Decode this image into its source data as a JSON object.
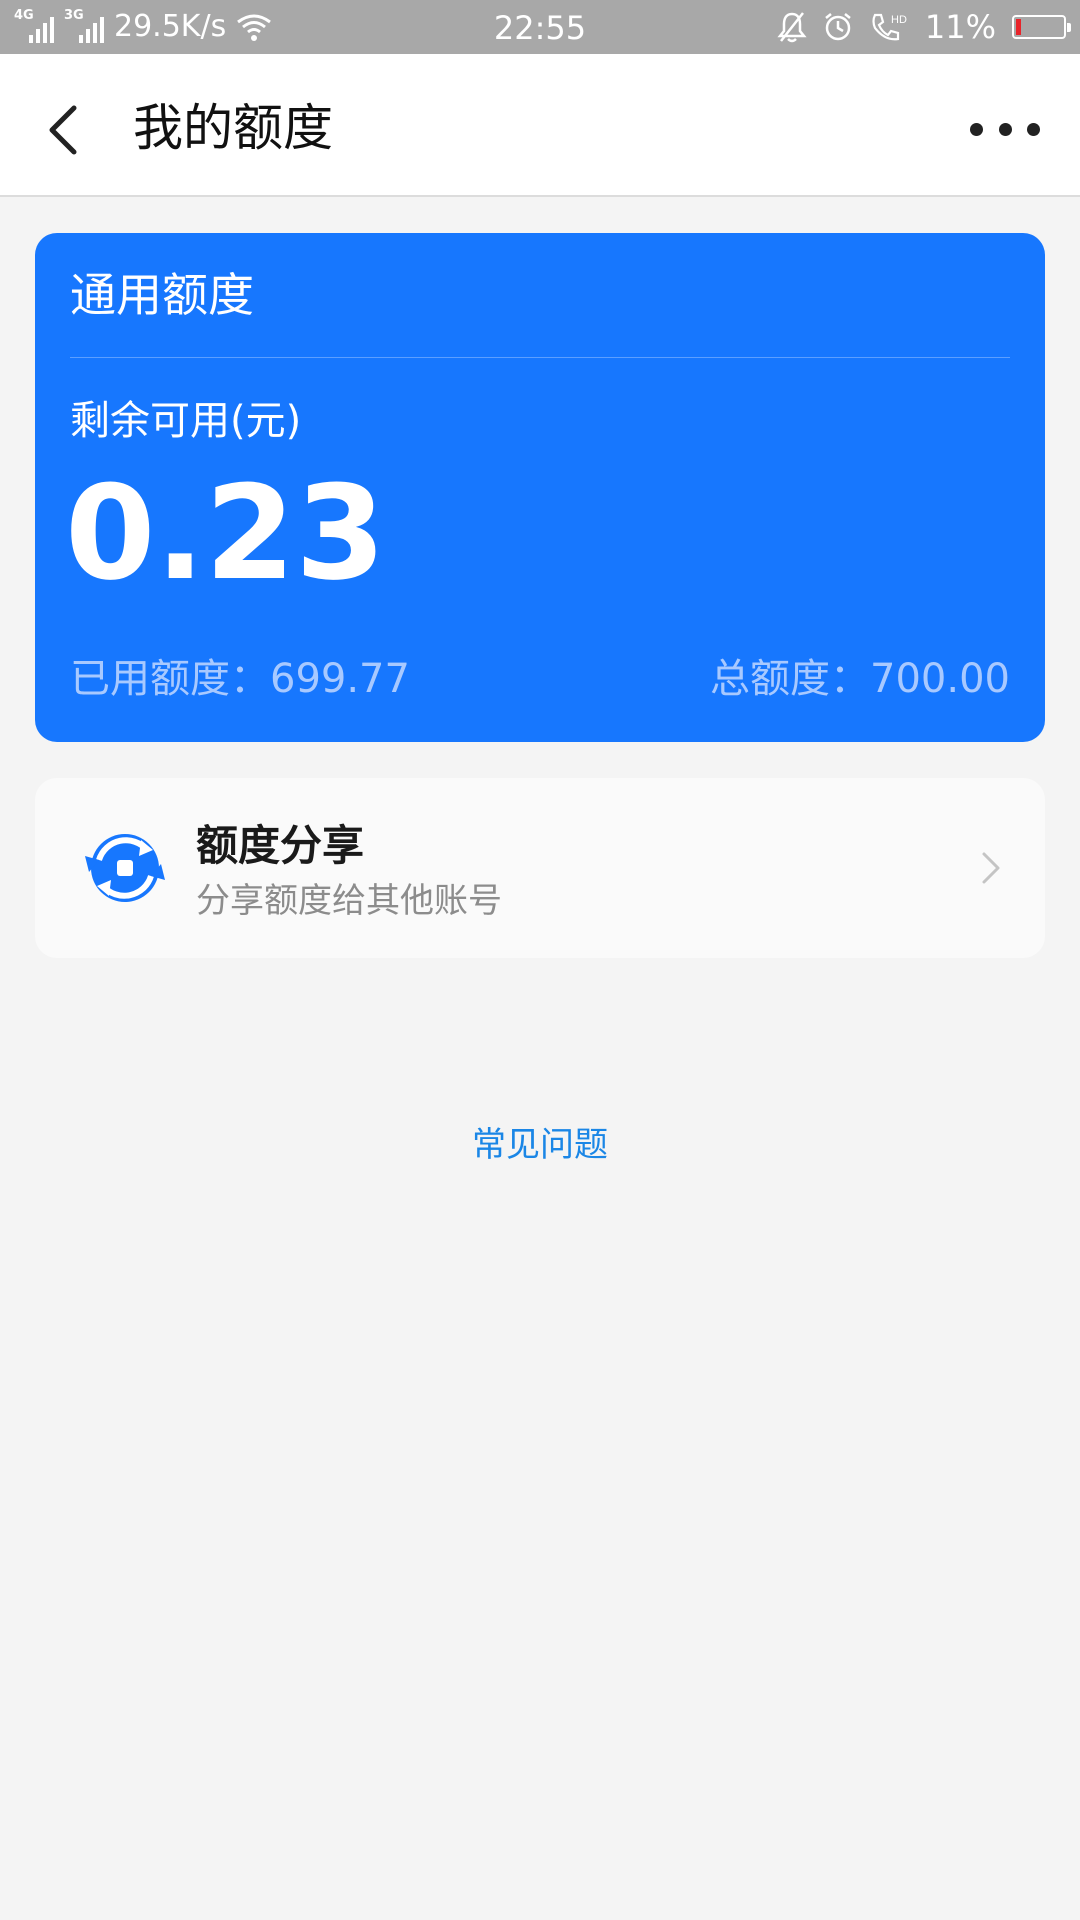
{
  "status_bar": {
    "net1": "4G",
    "net2": "3G",
    "speed": "29.5K/s",
    "time": "22:55",
    "battery_percent": "11%",
    "battery_level": 0.11,
    "battery_color": "#e8242a",
    "icons": [
      "signal-icon",
      "signal-icon",
      "wifi-icon",
      "mute-bell-icon",
      "alarm-icon",
      "hd-call-icon",
      "battery-icon"
    ]
  },
  "header": {
    "title": "我的额度"
  },
  "quota_card": {
    "title": "通用额度",
    "remaining_label": "剩余可用(元)",
    "remaining_value": "0.23",
    "used_text": "已用额度：699.77",
    "total_text": "总额度：700.00",
    "accent_color": "#1777fe"
  },
  "share": {
    "title": "额度分享",
    "subtitle": "分享额度给其他账号"
  },
  "faq": {
    "label": "常见问题",
    "color": "#1a86e6"
  }
}
